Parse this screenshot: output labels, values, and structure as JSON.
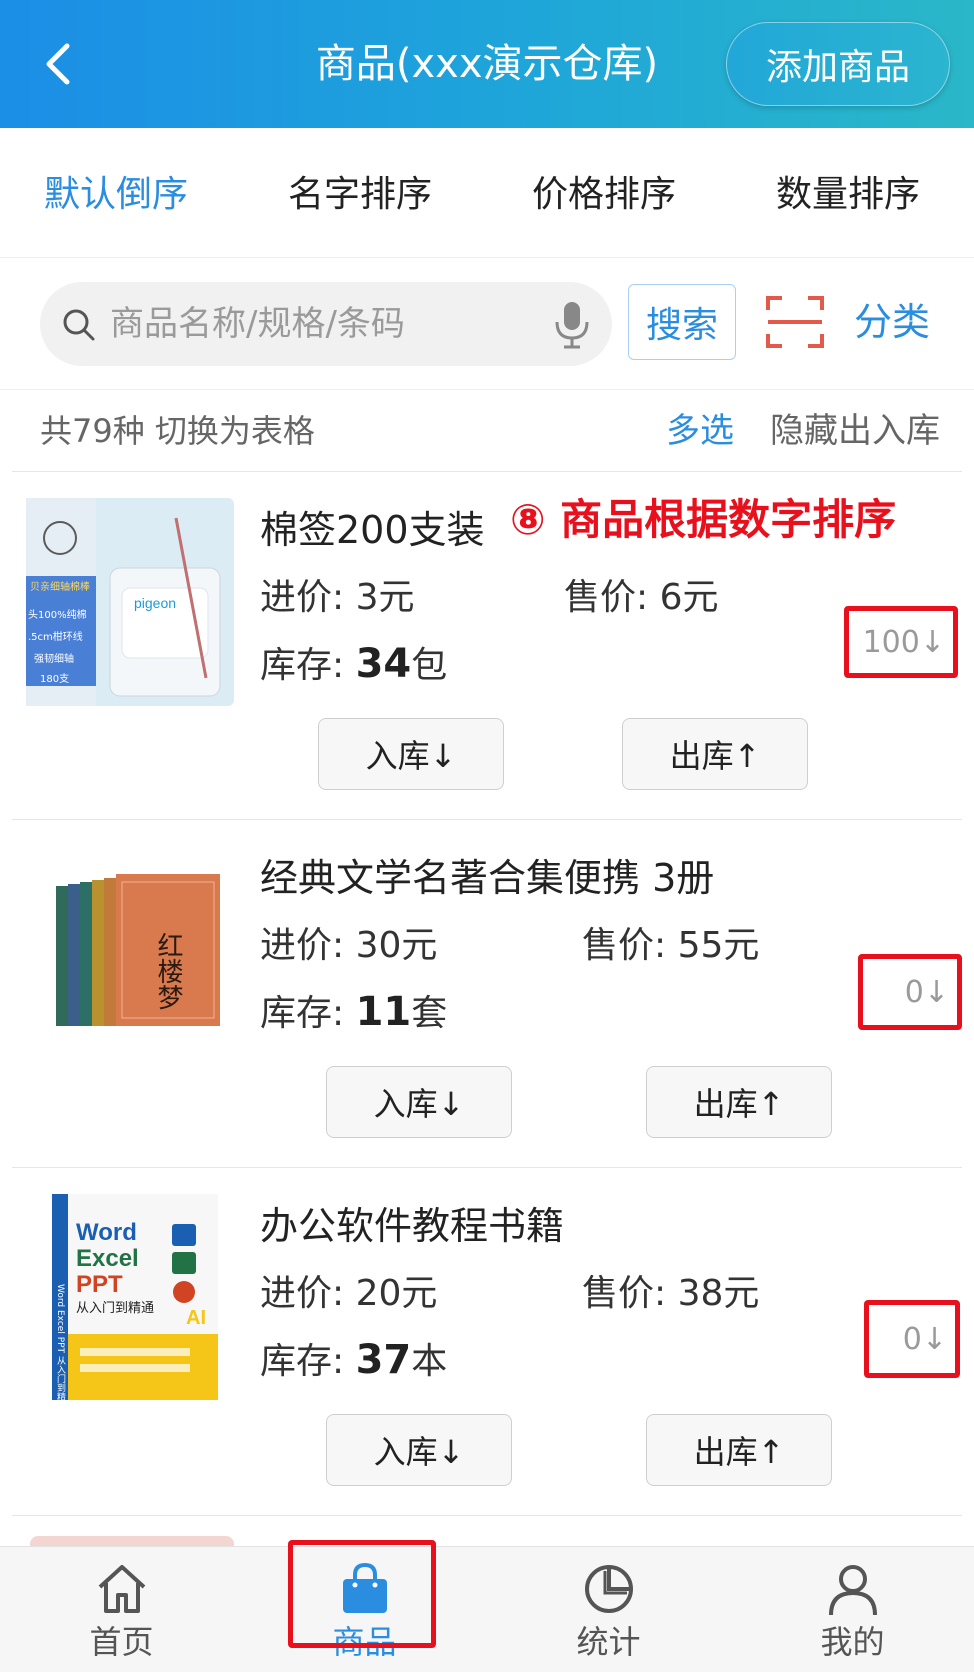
{
  "header": {
    "title": "商品(xxx演示仓库)",
    "add_button": "添加商品",
    "back_icon": "chevron-left-icon"
  },
  "sort_tabs": [
    "默认倒序",
    "名字排序",
    "价格排序",
    "数量排序"
  ],
  "search": {
    "placeholder": "商品名称/规格/条码",
    "value": "",
    "button": "搜索",
    "category": "分类"
  },
  "info": {
    "summary": "共79种  切换为表格",
    "multi_select": "多选",
    "hide_io": "隐藏出入库"
  },
  "annotation": "⑧ 商品根据数字排序",
  "products": [
    {
      "name": "棉签200支装",
      "cost_label": "进价:",
      "cost": "3元",
      "price_label": "售价:",
      "price": "6元",
      "stock_label": "库存:",
      "stock_qty": "34",
      "stock_unit": "包",
      "in_btn": "入库↓",
      "out_btn": "出库↑",
      "qty": "100↓"
    },
    {
      "name": "经典文学名著合集便携  3册",
      "cost_label": "进价:",
      "cost": "30元",
      "price_label": "售价:",
      "price": "55元",
      "stock_label": "库存:",
      "stock_qty": "11",
      "stock_unit": "套",
      "in_btn": "入库↓",
      "out_btn": "出库↑",
      "qty": "0↓"
    },
    {
      "name": "办公软件教程书籍",
      "cost_label": "进价:",
      "cost": "20元",
      "price_label": "售价:",
      "price": "38元",
      "stock_label": "库存:",
      "stock_qty": "37",
      "stock_unit": "本",
      "in_btn": "入库↓",
      "out_btn": "出库↑",
      "qty": "0↓"
    }
  ],
  "thumbs": {
    "p1": {
      "brand": "pigeon",
      "lines": [
        "贝亲细轴棉棒",
        "头100%纯棉",
        ".5cm柑环线",
        "强韧细轴",
        "180支"
      ]
    },
    "p2": {
      "title": "红楼梦"
    },
    "p3": {
      "lines": [
        "Word",
        "Excel",
        "PPT",
        "从入门到精通"
      ],
      "side": "Word Excel PPT 从入门到精通",
      "badge": "AI"
    }
  },
  "bottom_nav": [
    {
      "label": "首页",
      "icon": "home-icon"
    },
    {
      "label": "商品",
      "icon": "shopping-bag-icon",
      "active": true
    },
    {
      "label": "统计",
      "icon": "pie-chart-icon"
    },
    {
      "label": "我的",
      "icon": "user-icon"
    }
  ],
  "colors": {
    "accent": "#2a8de0",
    "highlight": "#e8101c",
    "header_start": "#1b8ee6",
    "header_end": "#2ab7c8"
  }
}
